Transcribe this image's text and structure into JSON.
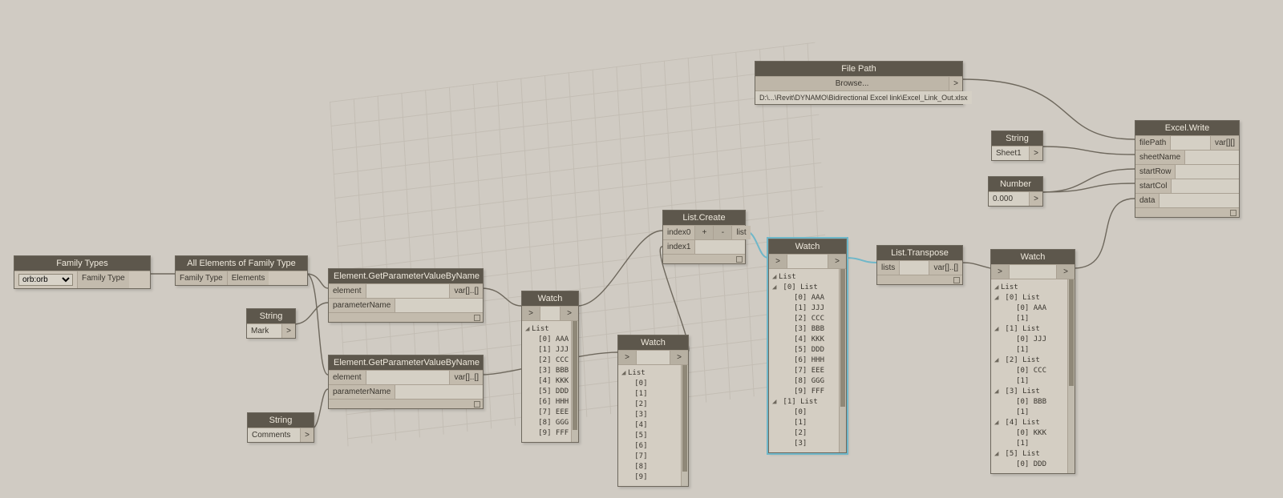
{
  "nodes": {
    "familyTypes": {
      "title": "Family Types",
      "dropdown": "orb:orb",
      "outPort": "Family Type"
    },
    "allElements": {
      "title": "All Elements of Family Type",
      "inPort": "Family Type",
      "outPort": "Elements"
    },
    "string1": {
      "title": "String",
      "value": "Mark",
      "chev": ">"
    },
    "string2": {
      "title": "String",
      "value": "Comments",
      "chev": ">"
    },
    "getParam1": {
      "title": "Element.GetParameterValueByName",
      "in1": "element",
      "in2": "parameterName",
      "out": "var[]..[]"
    },
    "getParam2": {
      "title": "Element.GetParameterValueByName",
      "in1": "element",
      "in2": "parameterName",
      "out": "var[]..[]"
    },
    "watch1": {
      "title": "Watch",
      "chevL": ">",
      "chevR": ">",
      "lines": [
        "⊿ List",
        "   [0] AAA",
        "   [1] JJJ",
        "   [2] CCC",
        "   [3] BBB",
        "   [4] KKK",
        "   [5] DDD",
        "   [6] HHH",
        "   [7] EEE",
        "   [8] GGG",
        "   [9] FFF"
      ]
    },
    "watch2": {
      "title": "Watch",
      "chevL": ">",
      "chevR": ">",
      "lines": [
        "⊿ List",
        "   [0]",
        "   [1]",
        "   [2]",
        "   [3]",
        "   [4]",
        "   [5]",
        "   [6]",
        "   [7]",
        "   [8]",
        "   [9]"
      ]
    },
    "listCreate": {
      "title": "List.Create",
      "in0": "index0",
      "plus": "+",
      "minus": "-",
      "out": "list",
      "in1": "index1"
    },
    "watch3": {
      "title": "Watch",
      "chevL": ">",
      "chevR": ">",
      "lines": [
        "⊿ List",
        " ⊿ [0] List",
        "     [0] AAA",
        "     [1] JJJ",
        "     [2] CCC",
        "     [3] BBB",
        "     [4] KKK",
        "     [5] DDD",
        "     [6] HHH",
        "     [7] EEE",
        "     [8] GGG",
        "     [9] FFF",
        " ⊿ [1] List",
        "     [0]",
        "     [1]",
        "     [2]",
        "     [3]"
      ]
    },
    "listTranspose": {
      "title": "List.Transpose",
      "in": "lists",
      "out": "var[]..[]"
    },
    "watch4": {
      "title": "Watch",
      "chevL": ">",
      "chevR": ">",
      "lines": [
        "⊿ List",
        " ⊿ [0] List",
        "     [0] AAA",
        "     [1]",
        " ⊿ [1] List",
        "     [0] JJJ",
        "     [1]",
        " ⊿ [2] List",
        "     [0] CCC",
        "     [1]",
        " ⊿ [3] List",
        "     [0] BBB",
        "     [1]",
        " ⊿ [4] List",
        "     [0] KKK",
        "     [1]",
        " ⊿ [5] List",
        "     [0] DDD"
      ]
    },
    "filePath": {
      "title": "File Path",
      "browse": "Browse...",
      "chev": ">",
      "path": "D:\\...\\Revit\\DYNAMO\\Bidirectional Excel link\\Excel_Link_Out.xlsx"
    },
    "string3": {
      "title": "String",
      "value": "Sheet1",
      "chev": ">"
    },
    "number": {
      "title": "Number",
      "value": "0.000",
      "chev": ">"
    },
    "excelWrite": {
      "title": "Excel.Write",
      "p1": "filePath",
      "p2": "sheetName",
      "p3": "startRow",
      "p4": "startCol",
      "p5": "data",
      "out": "var[][]"
    }
  }
}
